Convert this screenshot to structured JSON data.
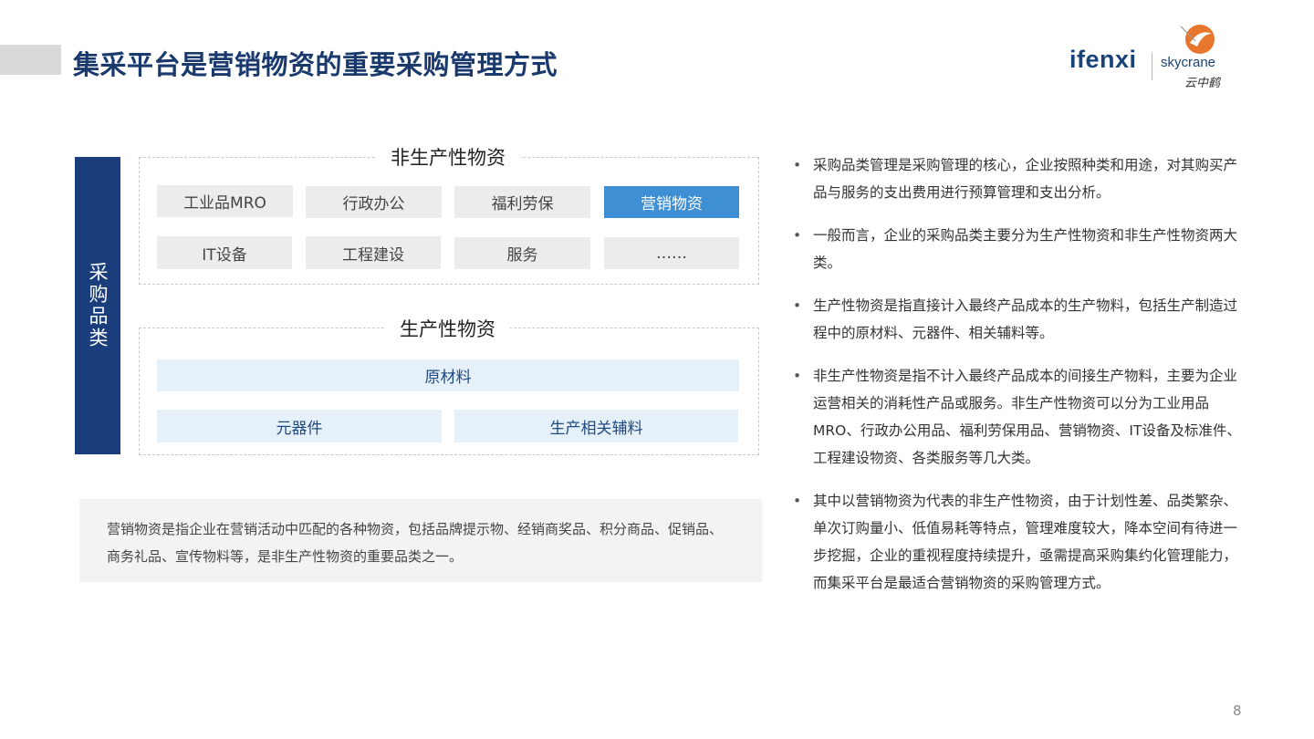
{
  "title": "集采平台是营销物资的重要采购管理方式",
  "logo": {
    "brand": "ifenxi",
    "partner": "skycrane",
    "partner_cn": "云中鹤"
  },
  "category_label": "采购品类",
  "non_production": {
    "title": "非生产性物资",
    "items": [
      "工业品MRO",
      "行政办公",
      "福利劳保",
      "营销物资",
      "IT设备",
      "工程建设",
      "服务",
      "……"
    ],
    "highlight": "营销物资"
  },
  "production": {
    "title": "生产性物资",
    "items": [
      "原材料",
      "元器件",
      "生产相关辅料"
    ]
  },
  "note": "营销物资是指企业在营销活动中匹配的各种物资，包括品牌提示物、经销商奖品、积分商品、促销品、商务礼品、宣传物料等，是非生产性物资的重要品类之一。",
  "bullets": [
    "采购品类管理是采购管理的核心，企业按照种类和用途，对其购买产品与服务的支出费用进行预算管理和支出分析。",
    "一般而言，企业的采购品类主要分为生产性物资和非生产性物资两大类。",
    "生产性物资是指直接计入最终产品成本的生产物料，包括生产制造过程中的原材料、元器件、相关辅料等。",
    "非生产性物资是指不计入最终产品成本的间接生产物料，主要为企业运营相关的消耗性产品或服务。非生产性物资可以分为工业用品MRO、行政办公用品、福利劳保用品、营销物资、IT设备及标准件、工程建设物资、各类服务等几大类。",
    "其中以营销物资为代表的非生产性物资，由于计划性差、品类繁杂、单次订购量小、低值易耗等特点，管理难度较大，降本空间有待进一步挖掘，企业的重视程度持续提升，亟需提高采购集约化管理能力，而集采平台是最适合营销物资的采购管理方式。"
  ],
  "page_number": "8",
  "colors": {
    "title": "#1a3a6e",
    "side_label": "#1a3d7c",
    "highlight": "#3e8fd4",
    "logo_accent": "#e8772e"
  }
}
